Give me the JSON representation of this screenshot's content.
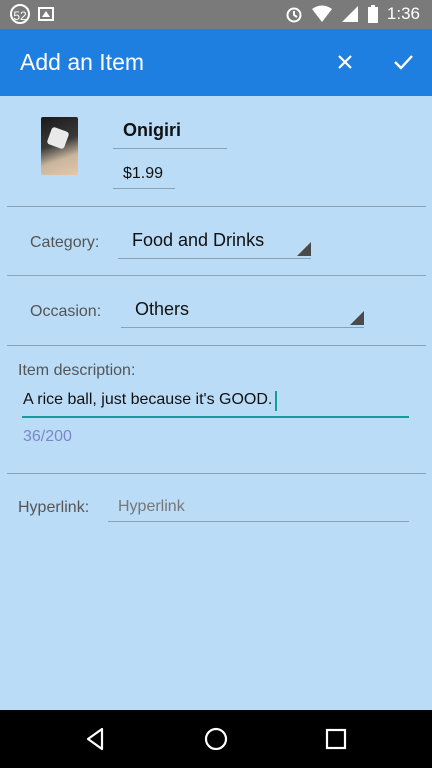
{
  "status_bar": {
    "notification_count": "52",
    "time": "1:36",
    "icons": [
      "image-icon",
      "alarm-icon",
      "wifi-icon",
      "signal-icon",
      "battery-icon"
    ]
  },
  "app_bar": {
    "title": "Add an Item",
    "actions": [
      "close-icon",
      "check-icon"
    ]
  },
  "item": {
    "name": "Onigiri",
    "price": "$1.99",
    "thumbnail": "onigiri-photo"
  },
  "category": {
    "label": "Category:",
    "value": "Food and Drinks"
  },
  "occasion": {
    "label": "Occasion:",
    "value": "Others"
  },
  "description": {
    "label": "Item description:",
    "value": "A rice ball, just because it's GOOD.",
    "counter": "36/200"
  },
  "hyperlink": {
    "label": "Hyperlink:",
    "placeholder": "Hyperlink",
    "value": ""
  },
  "navigation": [
    "back-icon",
    "home-icon",
    "recents-icon"
  ],
  "colors": {
    "app_bar": "#1f7fe0",
    "background": "#bbdcf7",
    "accent": "#189b9a",
    "counter": "#7b86c9"
  }
}
